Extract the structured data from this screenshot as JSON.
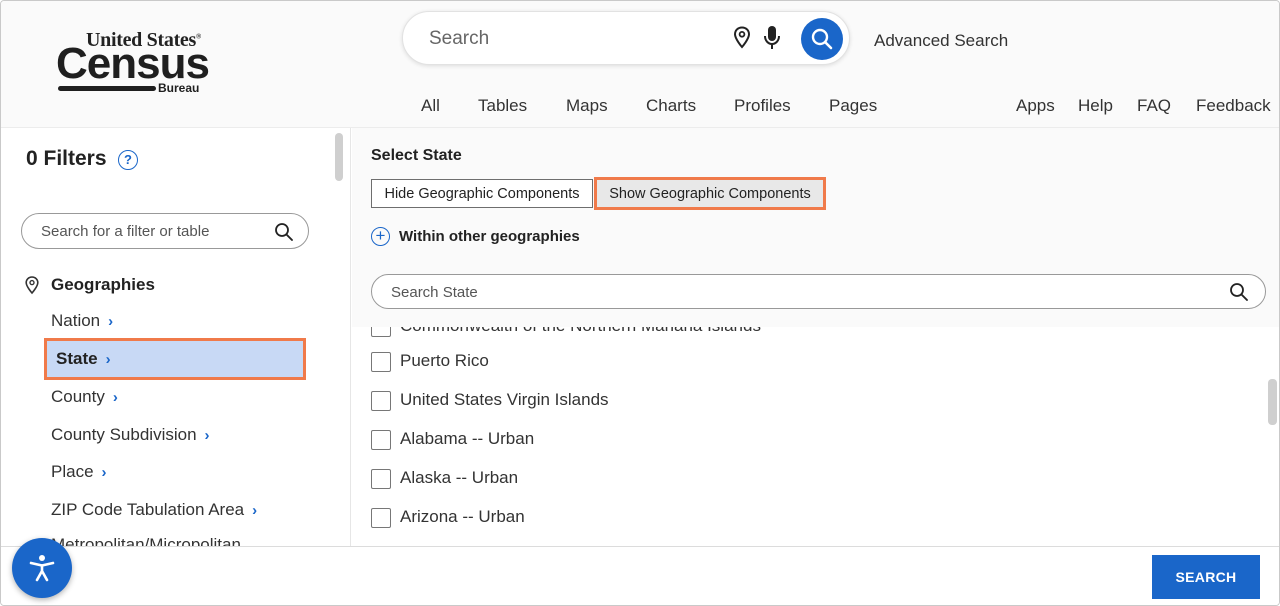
{
  "brand": {
    "line1": "United States",
    "line2": "Census",
    "line3": "Bureau",
    "registered": "®"
  },
  "search": {
    "placeholder": "Search",
    "advanced_label": "Advanced Search"
  },
  "nav": {
    "left": [
      "All",
      "Tables",
      "Maps",
      "Charts",
      "Profiles",
      "Pages"
    ],
    "right": [
      "Apps",
      "Help",
      "FAQ",
      "Feedback"
    ]
  },
  "sidebar": {
    "filters_title": "0 Filters",
    "help_glyph": "?",
    "search_placeholder": "Search for a filter or table",
    "geographies_heading": "Geographies",
    "items": [
      {
        "label": "Nation",
        "selected": false
      },
      {
        "label": "State",
        "selected": true
      },
      {
        "label": "County",
        "selected": false
      },
      {
        "label": "County Subdivision",
        "selected": false
      },
      {
        "label": "Place",
        "selected": false
      },
      {
        "label": "ZIP Code Tabulation Area",
        "selected": false
      },
      {
        "label": "Metropolitan/Micropolitan",
        "selected": false
      }
    ],
    "chevron": "›"
  },
  "panel": {
    "title": "Select State",
    "hide_label": "Hide Geographic Components",
    "show_label": "Show Geographic Components",
    "within_label": "Within other geographies",
    "within_glyph": "+",
    "search_placeholder": "Search State",
    "states": [
      "Commonwealth of the Northern Mariana Islands",
      "Puerto Rico",
      "United States Virgin Islands",
      "Alabama -- Urban",
      "Alaska -- Urban",
      "Arizona -- Urban"
    ]
  },
  "footer": {
    "search_button": "SEARCH"
  },
  "colors": {
    "accent": "#1a66c9",
    "highlight": "#f07a4a",
    "selected_bg": "#c8d9f5"
  }
}
